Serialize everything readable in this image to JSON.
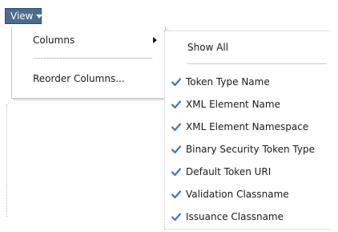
{
  "view_button": {
    "label": "View"
  },
  "columns_menu": {
    "items": [
      {
        "label": "Columns",
        "has_submenu": true
      },
      {
        "label": "Reorder Columns..."
      }
    ]
  },
  "columns_submenu": {
    "show_all_label": "Show All",
    "items": [
      {
        "label": "Token Type Name",
        "checked": true
      },
      {
        "label": "XML Element Name",
        "checked": true
      },
      {
        "label": "XML Element Namespace",
        "checked": true
      },
      {
        "label": "Binary Security Token Type",
        "checked": true
      },
      {
        "label": "Default Token URI",
        "checked": true
      },
      {
        "label": "Validation Classname",
        "checked": true
      },
      {
        "label": "Issuance Classname",
        "checked": true
      }
    ]
  },
  "colors": {
    "view_button_bg": "#4a6d8c",
    "checkmark": "#3a78c8"
  }
}
